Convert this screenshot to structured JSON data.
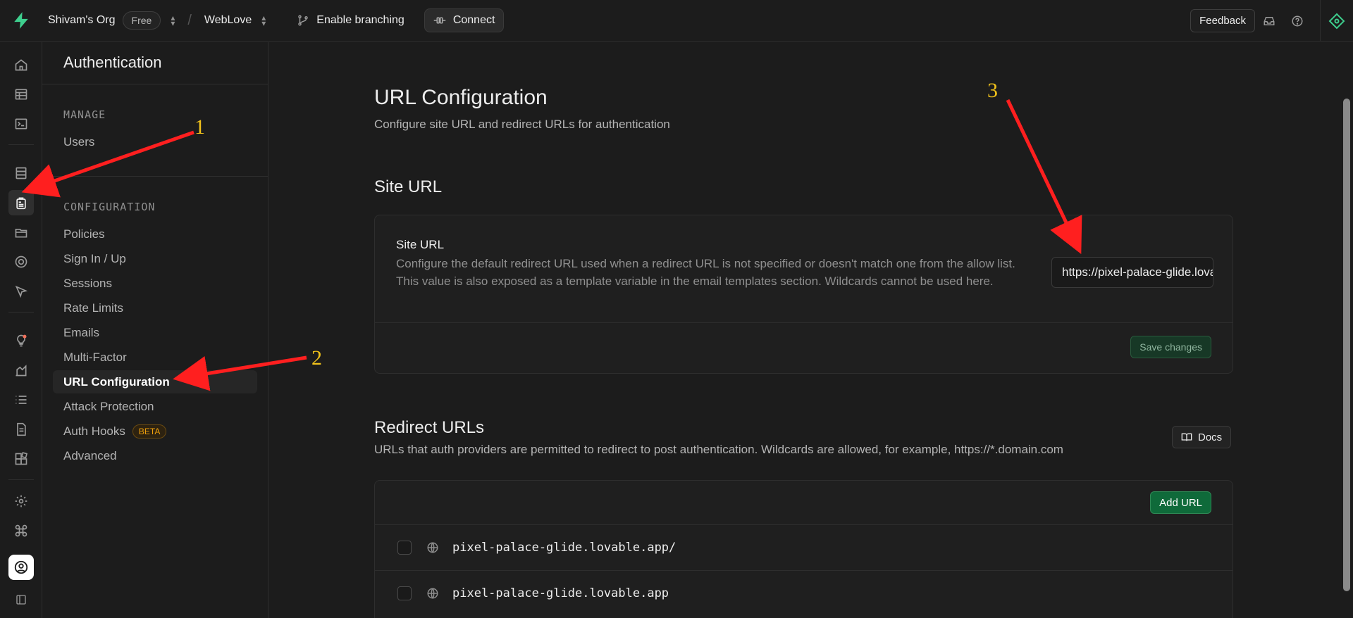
{
  "topbar": {
    "org": "Shivam's Org",
    "plan": "Free",
    "project": "WebLove",
    "branching": "Enable branching",
    "connect": "Connect",
    "feedback": "Feedback"
  },
  "menu": {
    "title": "Authentication",
    "manage_label": "MANAGE",
    "manage_items": [
      "Users"
    ],
    "config_label": "CONFIGURATION",
    "config_items": [
      "Policies",
      "Sign In / Up",
      "Sessions",
      "Rate Limits",
      "Emails",
      "Multi-Factor",
      "URL Configuration",
      "Attack Protection",
      "Auth Hooks",
      "Advanced"
    ],
    "beta_badge": "BETA",
    "active_item": "URL Configuration"
  },
  "page": {
    "title": "URL Configuration",
    "subtitle": "Configure site URL and redirect URLs for authentication"
  },
  "site_url": {
    "section_title": "Site URL",
    "label": "Site URL",
    "description": "Configure the default redirect URL used when a redirect URL is not specified or doesn't match one from the allow list. This value is also exposed as a template variable in the email templates section. Wildcards cannot be used here.",
    "value": "https://pixel-palace-glide.lovable.app",
    "save_label": "Save changes"
  },
  "redirect_urls": {
    "section_title": "Redirect URLs",
    "description": "URLs that auth providers are permitted to redirect to post authentication. Wildcards are allowed, for example, https://*.domain.com",
    "docs_label": "Docs",
    "add_label": "Add URL",
    "urls": [
      "pixel-palace-glide.lovable.app/",
      "pixel-palace-glide.lovable.app"
    ]
  },
  "annotations": [
    "1",
    "2",
    "3"
  ],
  "colors": {
    "accent": "#3ecf8e",
    "arrow": "#ff1f1f",
    "annotation": "#f1c21b"
  }
}
